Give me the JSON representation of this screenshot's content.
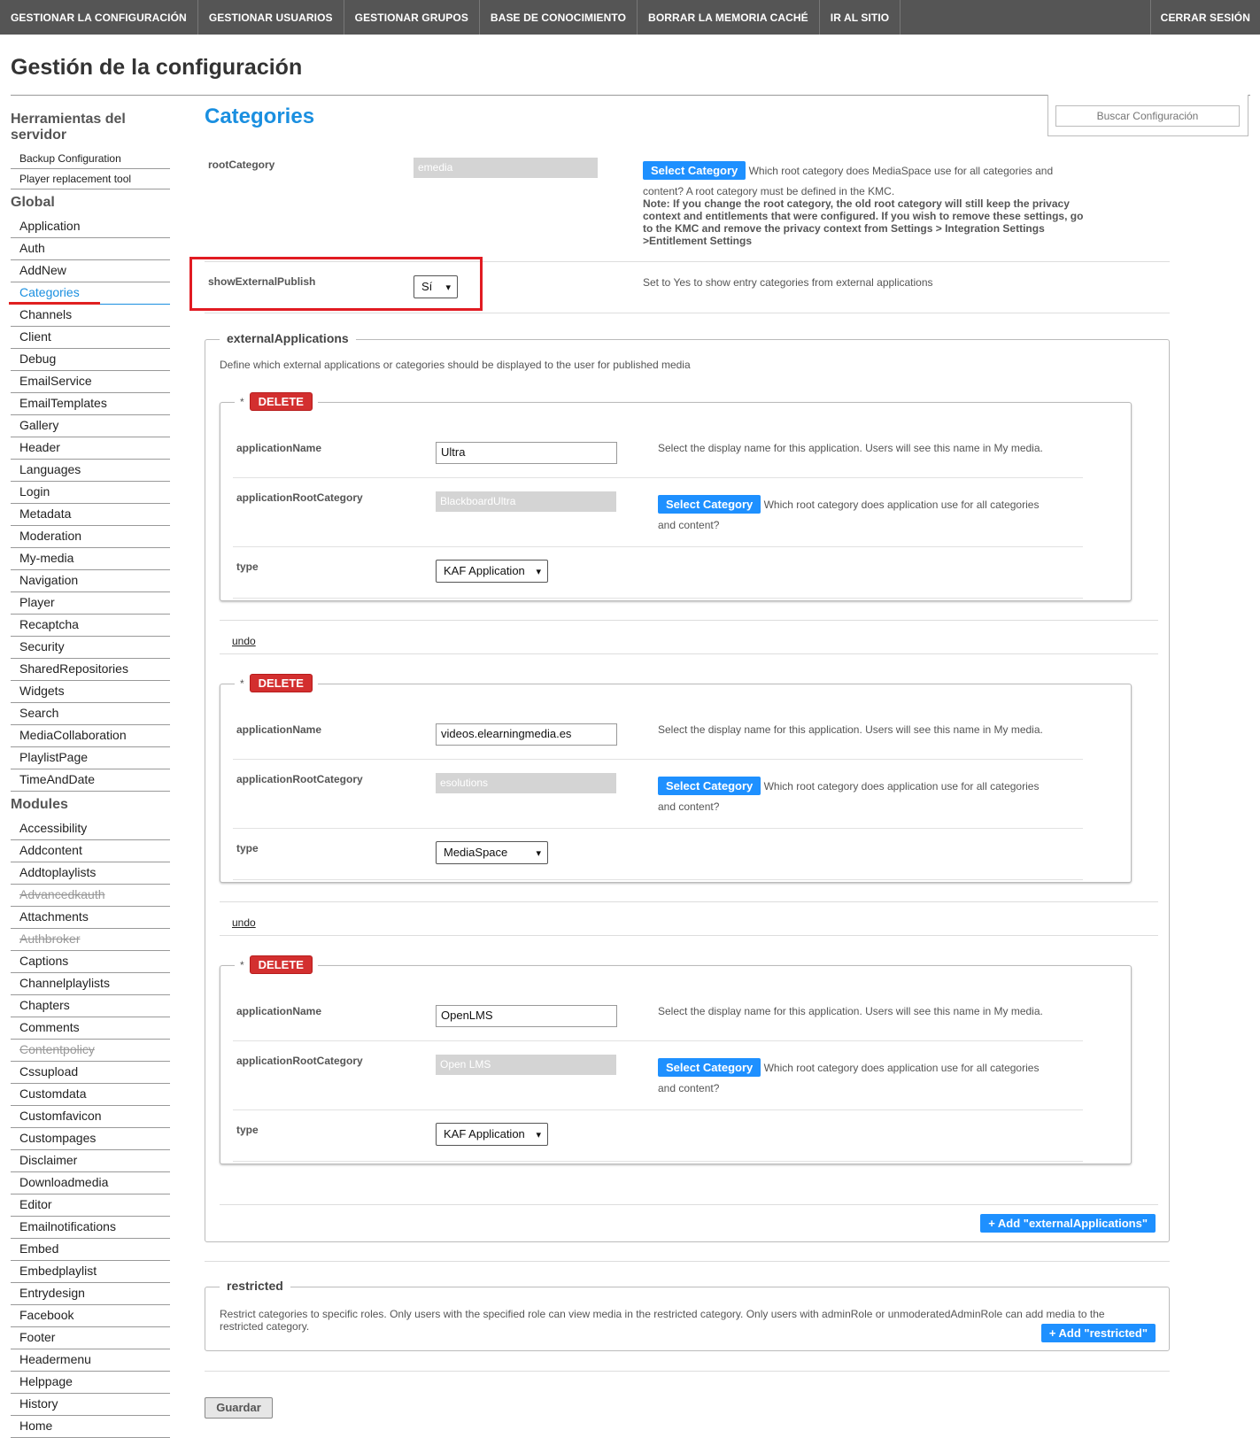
{
  "nav": {
    "items": [
      "GESTIONAR LA CONFIGURACIÓN",
      "GESTIONAR USUARIOS",
      "GESTIONAR GRUPOS",
      "BASE DE CONOCIMIENTO",
      "BORRAR LA MEMORIA CACHÉ",
      "IR AL SITIO"
    ],
    "logout": "CERRAR SESIÓN"
  },
  "page_title": "Gestión de la configuración",
  "search": {
    "placeholder": "Buscar Configuración"
  },
  "sidebar": {
    "tools_heading": "Herramientas del servidor",
    "tools": [
      "Backup Configuration",
      "Player replacement tool"
    ],
    "global_heading": "Global",
    "global": [
      "Application",
      "Auth",
      "AddNew",
      "Categories",
      "Channels",
      "Client",
      "Debug",
      "EmailService",
      "EmailTemplates",
      "Gallery",
      "Header",
      "Languages",
      "Login",
      "Metadata",
      "Moderation",
      "My-media",
      "Navigation",
      "Player",
      "Recaptcha",
      "Security",
      "SharedRepositories",
      "Widgets",
      "Search",
      "MediaCollaboration",
      "PlaylistPage",
      "TimeAndDate"
    ],
    "active": "Categories",
    "modules_heading": "Modules",
    "modules": [
      "Accessibility",
      "Addcontent",
      "Addtoplaylists",
      "Advancedkauth",
      "Attachments",
      "Authbroker",
      "Captions",
      "Channelplaylists",
      "Chapters",
      "Comments",
      "Contentpolicy",
      "Cssupload",
      "Customdata",
      "Customfavicon",
      "Custompages",
      "Disclaimer",
      "Downloadmedia",
      "Editor",
      "Emailnotifications",
      "Embed",
      "Embedplaylist",
      "Entrydesign",
      "Facebook",
      "Footer",
      "Headermenu",
      "Helppage",
      "History",
      "Home"
    ],
    "struck_modules": [
      "Advancedkauth",
      "Authbroker",
      "Contentpolicy"
    ]
  },
  "section_title": "Categories",
  "root_category": {
    "label": "rootCategory",
    "value": "emedia",
    "button": "Select Category",
    "desc_line1": "Which root category does MediaSpace use for all categories and",
    "desc_line2": "content? A root category must be defined in the KMC.",
    "note": "Note: If you change the root category, the old root category will still keep the privacy context and entitlements that were configured. If you wish to remove these settings, go to the KMC and remove the privacy context from Settings > Integration Settings >Entitlement Settings"
  },
  "show_external_publish": {
    "label": "showExternalPublish",
    "value": "Sí",
    "desc": "Set to Yes to show entry categories from external applications"
  },
  "external_applications": {
    "legend": "externalApplications",
    "desc": "Define which external applications or categories should be displayed to the user for published media",
    "delete_label": "DELETE",
    "undo_label": "undo",
    "name_label": "applicationName",
    "root_label": "applicationRootCategory",
    "type_label": "type",
    "name_desc": "Select the display name for this application. Users will see this name in My media.",
    "root_desc_1": "Which root category does application use for all categories",
    "root_desc_2": "and content?",
    "select_button": "Select Category",
    "apps": [
      {
        "name": "Ultra",
        "root": "BlackboardUltra",
        "type": "KAF Application"
      },
      {
        "name": "videos.elearningmedia.es",
        "root": "esolutions",
        "type": "MediaSpace"
      },
      {
        "name": "OpenLMS",
        "root": "Open LMS",
        "type": "KAF Application"
      }
    ],
    "add_button": "+ Add \"externalApplications\""
  },
  "restricted": {
    "legend": "restricted",
    "desc": "Restrict categories to specific roles. Only users with the specified role can view media in the restricted category. Only users with adminRole or unmoderatedAdminRole can add media to the restricted category.",
    "add_button": "+ Add \"restricted\""
  },
  "save_button": "Guardar",
  "colors": {
    "nav_bg": "#555555",
    "accent": "#1a8fe0",
    "button_blue": "#1e90ff",
    "delete_red": "#d32f2f",
    "highlight_red": "#e11b22"
  }
}
